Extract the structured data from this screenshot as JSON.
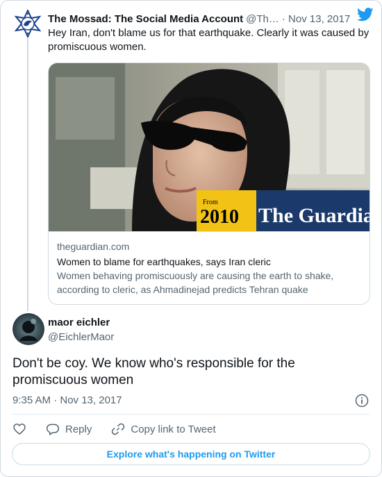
{
  "colors": {
    "accent": "#1d9bf0",
    "text": "#0f1419",
    "muted": "#536471",
    "border": "#cfd9de"
  },
  "parent_tweet": {
    "author_name": "The Mossad: The Social Media Account",
    "author_handle": "@Th…",
    "date": "· Nov 13, 2017",
    "text": "Hey Iran, don't blame us for that earthquake. Clearly it was caused by promiscuous women.",
    "avatar_icon": "mossad-emblem-icon",
    "source_icon": "twitter-bird-icon",
    "card": {
      "image_year_label": "From",
      "image_year": "2010",
      "image_brand": "The Guardian",
      "domain": "theguardian.com",
      "title": "Women to blame for earthquakes, says Iran cleric",
      "description": "Women behaving promiscuously are causing the earth to shake, according to cleric, as Ahmadinejad predicts Tehran quake"
    }
  },
  "main_tweet": {
    "author_name": "maor eichler",
    "author_handle": "@EichlerMaor",
    "text": "Don't be coy. We know who's responsible for the promiscuous women",
    "timestamp": "9:35 AM · Nov 13, 2017",
    "info_icon": "info-icon"
  },
  "actions": {
    "like_icon": "heart-icon",
    "reply_label": "Reply",
    "reply_icon": "reply-bubble-icon",
    "copy_label": "Copy link to Tweet",
    "copy_icon": "link-icon"
  },
  "explore": {
    "label": "Explore what's happening on Twitter"
  }
}
